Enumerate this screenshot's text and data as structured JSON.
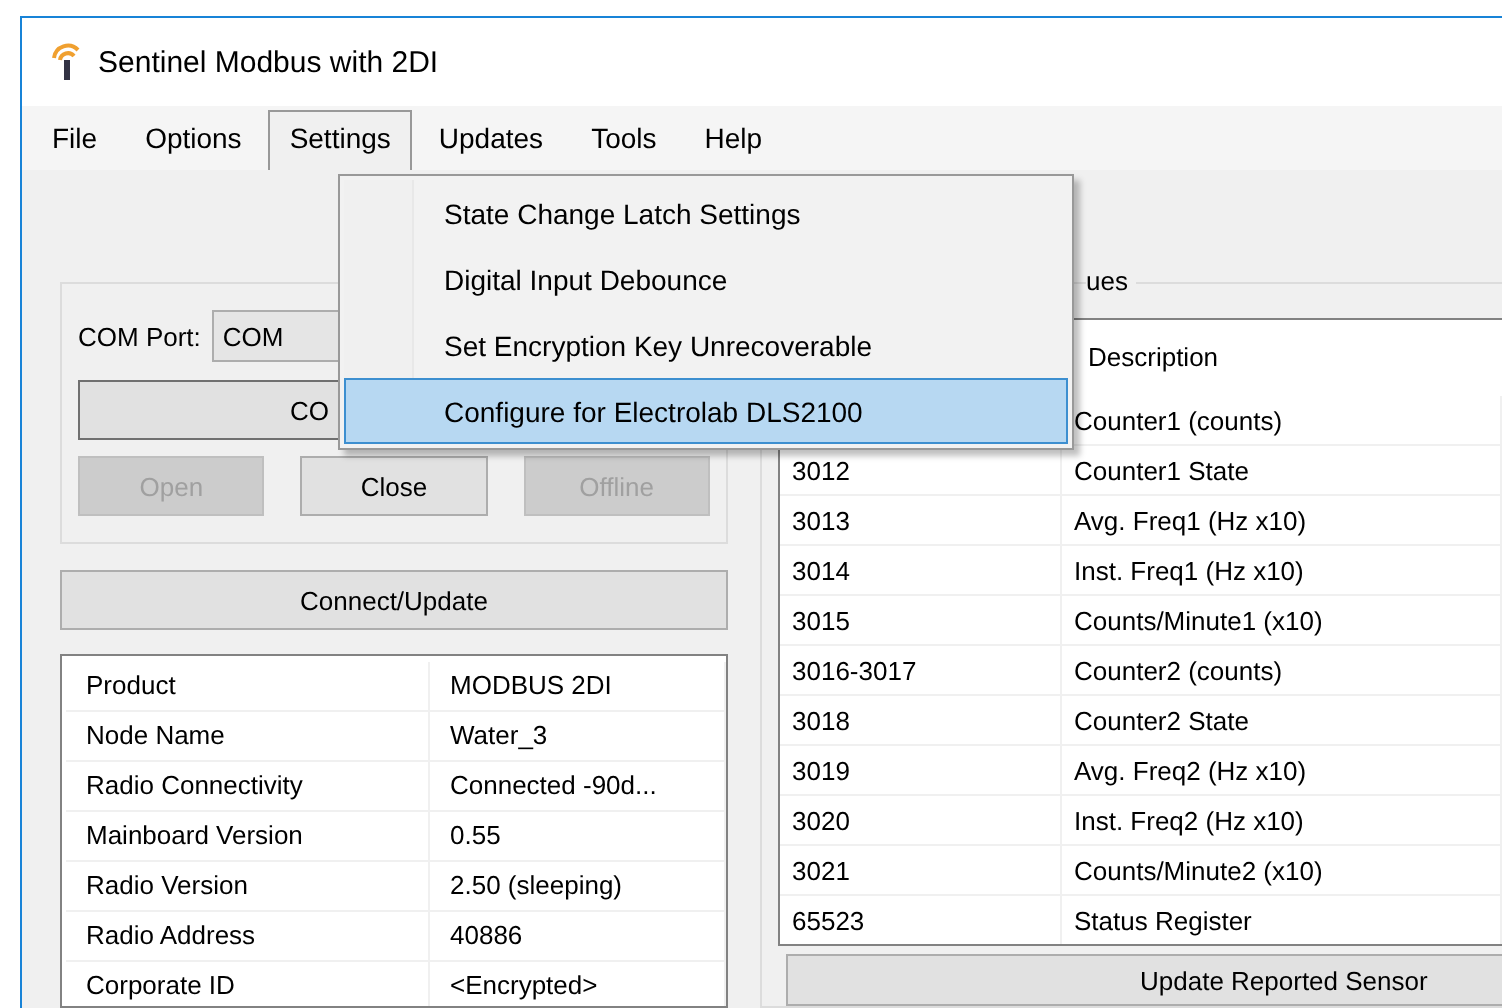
{
  "window": {
    "title": "Sentinel Modbus with 2DI"
  },
  "menu_bar": [
    {
      "label": "File",
      "selected": false
    },
    {
      "label": "Options",
      "selected": false
    },
    {
      "label": "Settings",
      "selected": true
    },
    {
      "label": "Updates",
      "selected": false
    },
    {
      "label": "Tools",
      "selected": false
    },
    {
      "label": "Help",
      "selected": false
    }
  ],
  "settings_menu": [
    {
      "label": "State Change Latch Settings",
      "selected": false
    },
    {
      "label": "Digital Input Debounce",
      "selected": false
    },
    {
      "label": "Set Encryption Key Unrecoverable",
      "selected": false
    },
    {
      "label": "Configure for Electrolab DLS2100",
      "selected": true
    }
  ],
  "connection": {
    "com_port_label": "COM Port:",
    "com_port_value": "COM",
    "connect_button": "CO",
    "buttons": [
      {
        "label": "Open",
        "disabled": true
      },
      {
        "label": "Close",
        "disabled": false
      },
      {
        "label": "Offline",
        "disabled": true
      }
    ]
  },
  "connect_update_button": "Connect/Update",
  "properties": [
    {
      "name": "Product",
      "value": "MODBUS 2DI"
    },
    {
      "name": "Node Name",
      "value": "Water_3"
    },
    {
      "name": "Radio Connectivity",
      "value": "Connected -90d..."
    },
    {
      "name": "Mainboard Version",
      "value": "0.55"
    },
    {
      "name": "Radio Version",
      "value": "2.50 (sleeping)"
    },
    {
      "name": "Radio Address",
      "value": "40886"
    },
    {
      "name": "Corporate ID",
      "value": "<Encrypted>"
    }
  ],
  "registers": {
    "group_title": "ues",
    "column_2": "Description",
    "rows": [
      {
        "description": "Counter1 (counts)"
      },
      {
        "register": "3012",
        "description": "Counter1 State"
      },
      {
        "register": "3013",
        "description": "Avg. Freq1 (Hz x10)"
      },
      {
        "register": "3014",
        "description": "Inst. Freq1 (Hz x10)"
      },
      {
        "register": "3015",
        "description": "Counts/Minute1 (x10)"
      },
      {
        "register": "3016-3017",
        "description": "Counter2 (counts)"
      },
      {
        "register": "3018",
        "description": "Counter2 State"
      },
      {
        "register": "3019",
        "description": "Avg. Freq2 (Hz x10)"
      },
      {
        "register": "3020",
        "description": "Inst. Freq2 (Hz x10)"
      },
      {
        "register": "3021",
        "description": "Counts/Minute2 (x10)"
      },
      {
        "register": "65523",
        "description": "Status Register"
      }
    ]
  },
  "update_button": "Update Reported Sensor"
}
